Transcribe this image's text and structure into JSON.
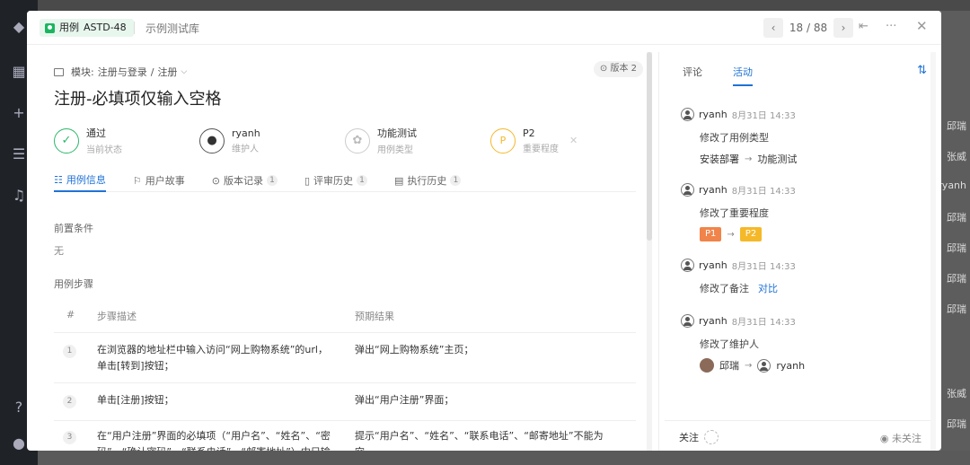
{
  "background": {
    "right_cells": [
      "邱瑞",
      "张威",
      "ryanh",
      "邱瑞",
      "邱瑞",
      "邱瑞",
      "邱瑞",
      "张威",
      "邱瑞"
    ]
  },
  "header": {
    "tag_label": "用例",
    "case_id": "ASTD-48",
    "library": "示例测试库",
    "pager": "18 / 88",
    "prev_icon": "chevron-left-icon",
    "next_icon": "chevron-right-icon"
  },
  "case": {
    "crumb_prefix": "模块:",
    "crumb_path": "注册与登录",
    "crumb_sep": "/",
    "crumb_leaf": "注册",
    "version": "版本 2",
    "title": "注册-必填项仅输入空格",
    "props": [
      {
        "value": "通过",
        "label": "当前状态",
        "icon": "check-icon",
        "color": "#2cb86b"
      },
      {
        "value": "ryanh",
        "label": "维护人",
        "icon": "user-icon",
        "color": "#333333"
      },
      {
        "value": "功能测试",
        "label": "用例类型",
        "icon": "type-icon",
        "color": "#bbbbbb"
      },
      {
        "value": "P2",
        "label": "重要程度",
        "icon": "priority-icon",
        "color": "#f5b829"
      }
    ],
    "tabs": [
      {
        "label": "用例信息",
        "count": ""
      },
      {
        "label": "用户故事",
        "count": ""
      },
      {
        "label": "版本记录",
        "count": "1"
      },
      {
        "label": "评审历史",
        "count": "1"
      },
      {
        "label": "执行历史",
        "count": "1"
      }
    ],
    "precondition_label": "前置条件",
    "precondition_value": "无",
    "steps_label": "用例步骤",
    "columns": [
      "#",
      "步骤描述",
      "预期结果"
    ],
    "steps": [
      {
        "n": "1",
        "desc": "在浏览器的地址栏中输入访问“网上购物系统”的url，单击[转到]按钮；",
        "result": "弹出“网上购物系统”主页；"
      },
      {
        "n": "2",
        "desc": "单击[注册]按钮；",
        "result": "弹出“用户注册”界面；"
      },
      {
        "n": "3",
        "desc": "在“用户注册”界面的必填项（“用户名”、“姓名”、“密码”、“确认密码”、“联系电话”、“邮寄地址”）中只输入",
        "result": "提示“用户名”、“姓名”、“联系电话”、“邮寄地址”不能为空"
      }
    ]
  },
  "activity": {
    "tabs": [
      "评论",
      "活动"
    ],
    "items": [
      {
        "user": "ryanh",
        "time": "8月31日 14:33",
        "action": "修改了用例类型",
        "from": "安装部署",
        "to": "功能测试"
      },
      {
        "user": "ryanh",
        "time": "8月31日 14:33",
        "action": "修改了重要程度",
        "from": "P1",
        "to": "P2",
        "from_color": "#f0844a",
        "to_color": "#f5b829"
      },
      {
        "user": "ryanh",
        "time": "8月31日 14:33",
        "action": "修改了备注",
        "link": "对比"
      },
      {
        "user": "ryanh",
        "time": "8月31日 14:33",
        "action": "修改了维护人",
        "from": "邱瑞",
        "to": "ryanh"
      }
    ],
    "follow_label": "关注",
    "unfollow_label": "未关注"
  },
  "colors": {
    "accent": "#1f72d6",
    "pass": "#2cb86b",
    "tag_bg": "#e8f7ee"
  }
}
